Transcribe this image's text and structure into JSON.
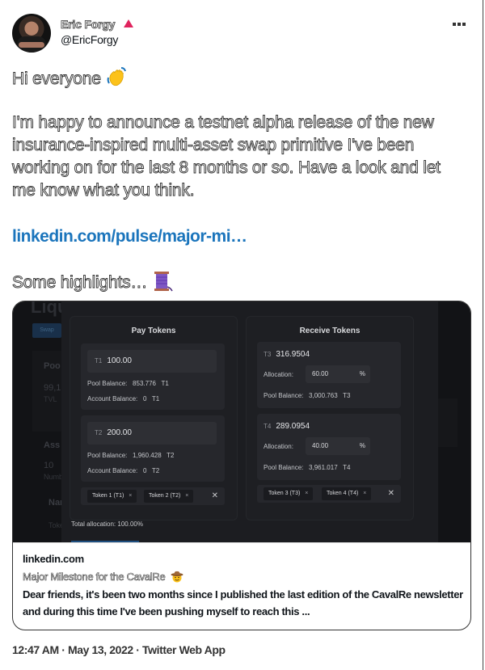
{
  "author": {
    "display_name": "Eric Forgy",
    "handle": "@EricForgy",
    "badge_icon": "red-triangle-icon",
    "avatar_alt": "profile photo"
  },
  "menu": {
    "more_icon": "more-horizontal-icon"
  },
  "tweet": {
    "greeting": "Hi everyone",
    "greeting_emoji": "waving-hand-icon",
    "body": "I'm happy to announce a testnet alpha release of the new insurance-inspired multi-asset swap primitive I've been working on for the last 8 months or so. Have a look and let me know what you think.",
    "link_text": "linkedin.com/pulse/major-mi…",
    "highlights": "Some highlights…",
    "highlights_emoji": "thread-spool-icon"
  },
  "media": {
    "background": {
      "title": "Liqu",
      "swap_button": "Swap",
      "pool_label": "Poo",
      "pool_value": "99,1",
      "tvl_label": "TVL",
      "assets_label": "Ass",
      "assets_value": "10",
      "number_label": "Numb",
      "name_label": "Nar",
      "token_label": "Toke"
    },
    "pay": {
      "title": "Pay Tokens",
      "tokens": [
        {
          "tag": "T1",
          "amount": "100.00",
          "pool_balance_label": "Pool Balance:",
          "pool_balance": "853.776",
          "pool_unit": "T1",
          "account_balance_label": "Account Balance:",
          "account_balance": "0",
          "account_unit": "T1"
        },
        {
          "tag": "T2",
          "amount": "200.00",
          "pool_balance_label": "Pool Balance:",
          "pool_balance": "1,960.428",
          "pool_unit": "T2",
          "account_balance_label": "Account Balance:",
          "account_balance": "0",
          "account_unit": "T2"
        }
      ],
      "chips": [
        "Token 1 (T1)",
        "Token 2 (T2)"
      ],
      "chip_remove": "×",
      "clear": "✕"
    },
    "receive": {
      "title": "Receive Tokens",
      "tokens": [
        {
          "tag": "T3",
          "amount": "316.9504",
          "allocation_label": "Allocation:",
          "allocation": "60.00",
          "pct": "%",
          "pool_balance_label": "Pool Balance:",
          "pool_balance": "3,000.763",
          "pool_unit": "T3"
        },
        {
          "tag": "T4",
          "amount": "289.0954",
          "allocation_label": "Allocation:",
          "allocation": "40.00",
          "pct": "%",
          "pool_balance_label": "Pool Balance:",
          "pool_balance": "3,961.017",
          "pool_unit": "T4"
        }
      ],
      "chips": [
        "Token 3 (T3)",
        "Token 4 (T4)"
      ],
      "chip_remove": "×",
      "clear": "✕"
    },
    "total_allocation": "Total allocation: 100.00%"
  },
  "card": {
    "domain": "linkedin.com",
    "title": "Major Milestone for the CavalRe",
    "title_emoji": "cowboy-face-icon",
    "description": "Dear friends, it's been two months since I published the last edition of the CavalRe newsletter and during this time I've been pushing myself to reach this ..."
  },
  "footer": {
    "timestamp": "12:47 AM · May 13, 2022 · Twitter Web App"
  }
}
